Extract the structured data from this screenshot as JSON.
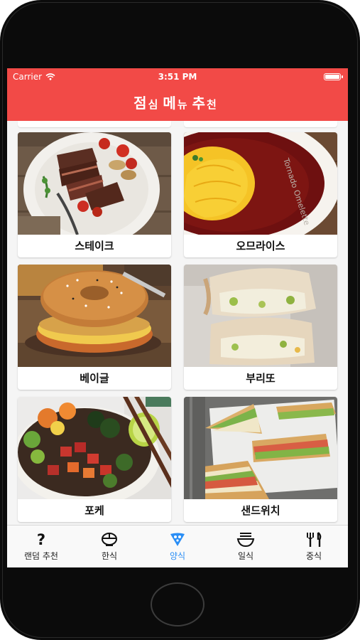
{
  "status_bar": {
    "carrier": "Carrier",
    "time": "3:51 PM",
    "battery_level": 1.0
  },
  "header": {
    "title_part1": "점",
    "title_part1_small": "심",
    "title_part2": "메",
    "title_part2_small": "뉴",
    "title_part3": "추",
    "title_part3_small": "천"
  },
  "menu_items": [
    {
      "label": "스테이크"
    },
    {
      "label": "오므라이스"
    },
    {
      "label": "베이글"
    },
    {
      "label": "부리또"
    },
    {
      "label": "포케"
    },
    {
      "label": "샌드위치"
    }
  ],
  "photo_text": {
    "omelette_plate": "Tornado Omelette"
  },
  "tabs": [
    {
      "label": "랜덤 추천",
      "icon": "question-mark-icon",
      "active": false
    },
    {
      "label": "한식",
      "icon": "bibimbap-bowl-icon",
      "active": false
    },
    {
      "label": "양식",
      "icon": "pizza-slice-icon",
      "active": true
    },
    {
      "label": "일식",
      "icon": "ramen-bowl-icon",
      "active": false
    },
    {
      "label": "중식",
      "icon": "utensils-icon",
      "active": false
    }
  ],
  "colors": {
    "header": "#f24a47",
    "active_tab": "#2a8ef5",
    "text": "#111111"
  }
}
